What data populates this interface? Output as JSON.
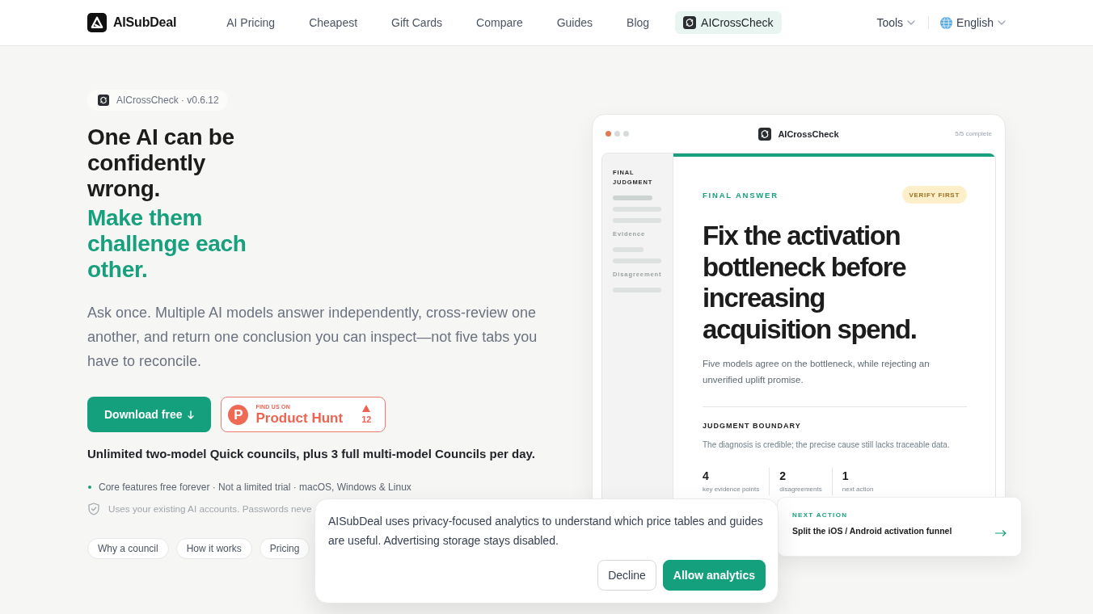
{
  "header": {
    "brand": "AISubDeal",
    "nav": [
      {
        "label": "AI Pricing",
        "kind": "link",
        "selected": false
      },
      {
        "label": "Cheapest",
        "kind": "link",
        "selected": false
      },
      {
        "label": "Gift Cards",
        "kind": "link",
        "selected": false
      },
      {
        "label": "Compare",
        "kind": "link",
        "selected": false
      },
      {
        "label": "Guides",
        "kind": "link",
        "selected": false
      },
      {
        "label": "Blog",
        "kind": "link",
        "selected": false
      },
      {
        "label": "AICrossCheck",
        "kind": "product",
        "selected": true
      }
    ],
    "menus": [
      {
        "label": "Tools",
        "kind": "dropdown"
      },
      {
        "label": "English",
        "kind": "language"
      }
    ]
  },
  "hero": {
    "badge": "AICrossCheck · v0.6.12",
    "headline": "One AI can be confidently wrong.",
    "headline_accent": "Make them challenge each other.",
    "lead": "Ask once. Multiple AI models answer independently, cross-review one another, and return one conclusion you can inspect—not five tabs you have to reconcile.",
    "cta": {
      "label": "Download free"
    },
    "product_hunt": {
      "logo_letter": "P",
      "kicker": "FIND US ON",
      "name": "Product Hunt",
      "votes": "12"
    },
    "offer": "Unlimited two-model Quick councils, plus 3 full multi-model Councils per day.",
    "notes": [
      {
        "kind": "bullet",
        "text": "Core features free forever · Not a limited trial · macOS, Windows & Linux"
      },
      {
        "kind": "shield",
        "text": "Uses your existing AI accounts. Passwords neve"
      }
    ],
    "chips": [
      {
        "label": "Why a council"
      },
      {
        "label": "How it works"
      },
      {
        "label": "Pricing"
      }
    ]
  },
  "preview": {
    "app_title": "AICrossCheck",
    "status": "5/5 complete",
    "progress": {
      "level": 1
    },
    "sidebar": [
      {
        "label": "FINAL JUDGMENT",
        "selected": true
      },
      {
        "label": "Evidence",
        "selected": false
      },
      {
        "label": "Disagreement",
        "selected": false
      }
    ],
    "eyebrow": "FINAL ANSWER",
    "badge": "VERIFY FIRST",
    "headline": "Fix the activation bottleneck before increasing acquisition spend.",
    "summary": "Five models agree on the bottleneck, while rejecting an unverified uplift promise.",
    "boundary_title": "JUDGMENT BOUNDARY",
    "boundary_text": "The diagnosis is credible; the precise cause still lacks traceable data.",
    "stats": [
      {
        "value": "4",
        "label": "key evidence points"
      },
      {
        "value": "2",
        "label": "disagreements"
      },
      {
        "value": "1",
        "label": "next action"
      }
    ],
    "next_action": {
      "eyebrow": "NEXT ACTION",
      "text": "Split the iOS / Android activation funnel"
    }
  },
  "cookie_banner": {
    "text": "AISubDeal uses privacy-focused analytics to understand which price tables and guides are useful. Advertising storage stays disabled.",
    "buttons": [
      {
        "label": "Decline",
        "kind": "decline"
      },
      {
        "label": "Allow analytics",
        "kind": "accept"
      }
    ]
  }
}
